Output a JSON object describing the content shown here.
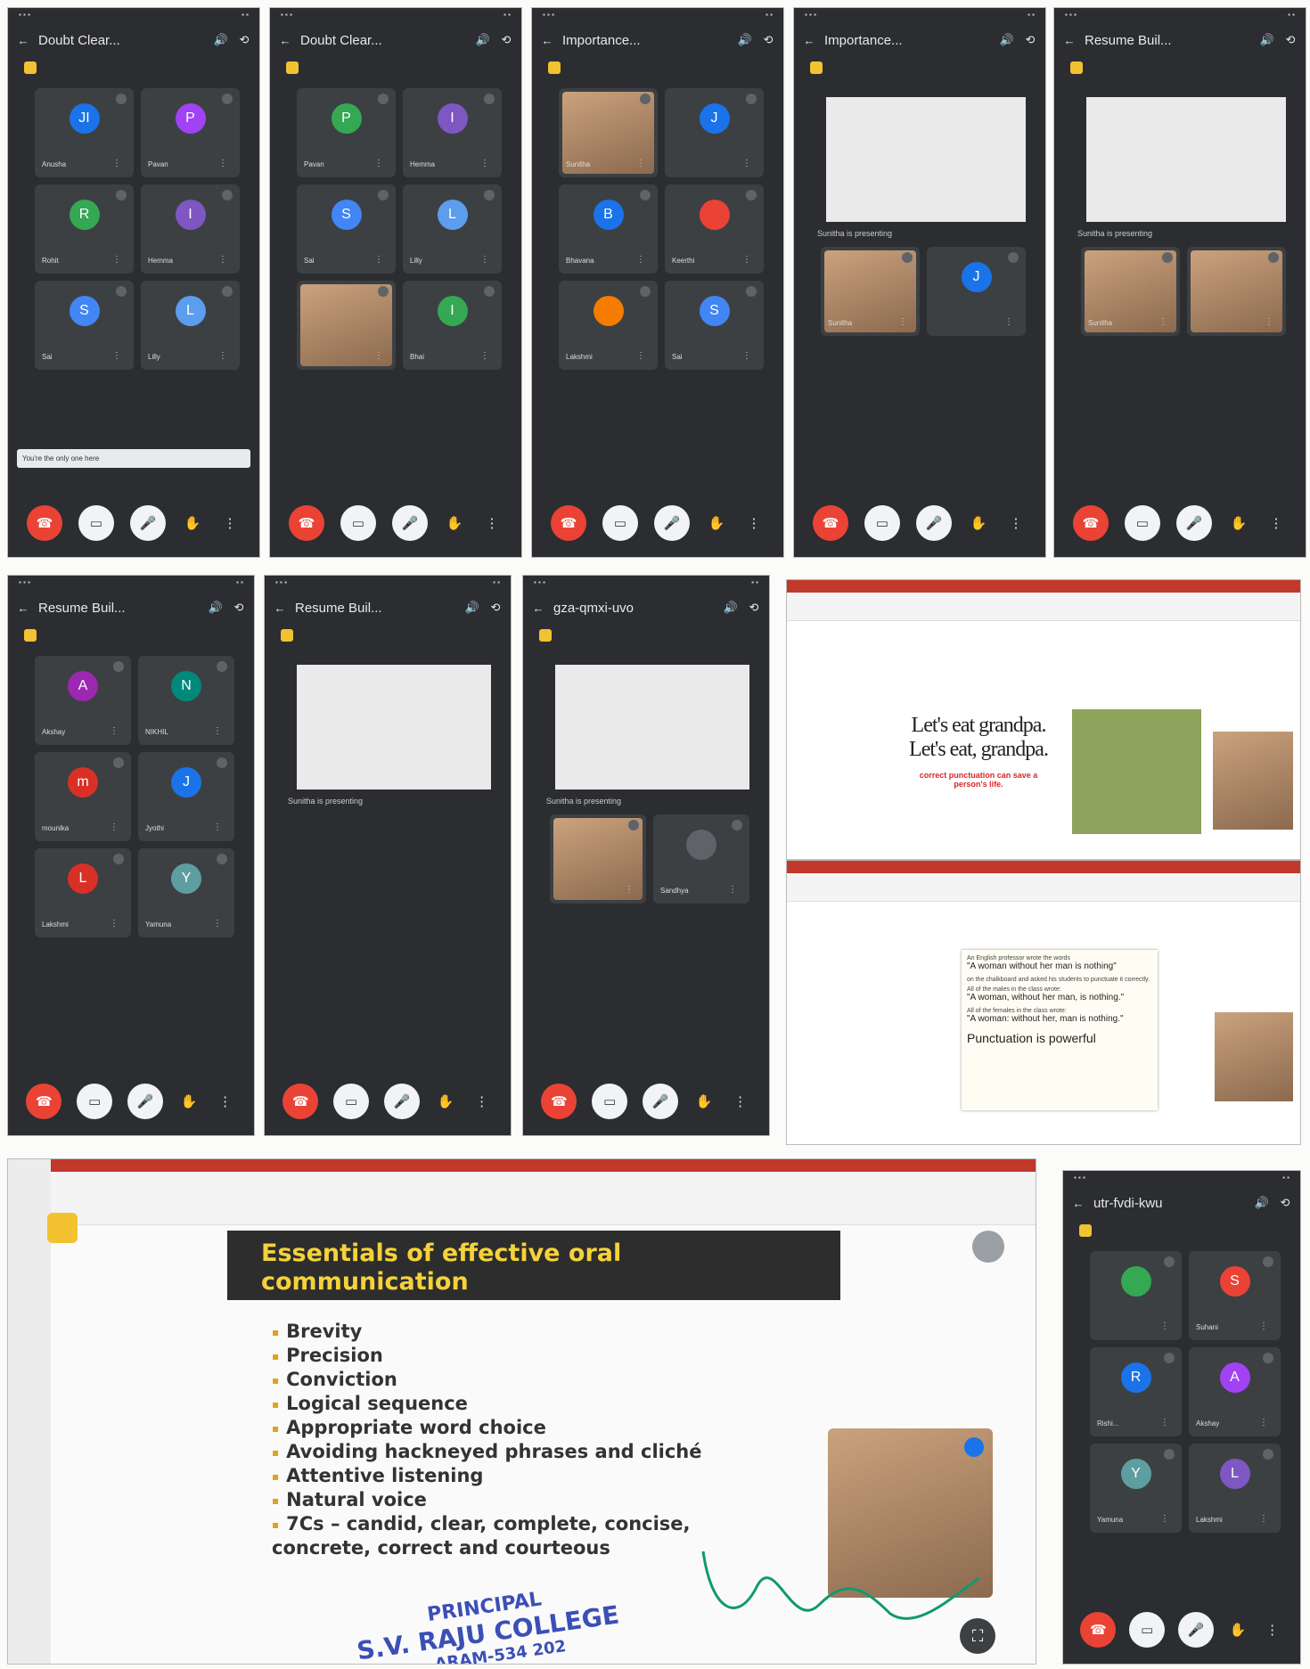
{
  "phones_row1": [
    {
      "title": "Doubt Clear...",
      "participants": [
        {
          "initial": "JI",
          "name": "Anusha",
          "color": "#1a73e8"
        },
        {
          "initial": "P",
          "name": "Pavan",
          "color": "#a142f4"
        },
        {
          "initial": "R",
          "name": "Rohit",
          "color": "#34a853"
        },
        {
          "initial": "I",
          "name": "Hemma",
          "color": "#7e57c2"
        },
        {
          "initial": "S",
          "name": "Sai",
          "color": "#4285f4"
        },
        {
          "initial": "L",
          "name": "Lilly",
          "color": "#5c9ded"
        }
      ],
      "notice": "You're the only one here"
    },
    {
      "title": "Doubt Clear...",
      "participants": [
        {
          "initial": "P",
          "name": "Pavan",
          "color": "#34a853"
        },
        {
          "initial": "I",
          "name": "Hemma",
          "color": "#7e57c2"
        },
        {
          "initial": "S",
          "name": "Sai",
          "color": "#4285f4"
        },
        {
          "initial": "L",
          "name": "Lilly",
          "color": "#5c9ded"
        },
        {
          "initial": "",
          "name": "",
          "color": ""
        },
        {
          "initial": "I",
          "name": "Bhai",
          "color": "#34a853"
        }
      ],
      "notice": ""
    },
    {
      "title": "Importance...",
      "participants": [
        {
          "initial": "",
          "name": "Sunitha",
          "color": ""
        },
        {
          "initial": "J",
          "name": "",
          "color": "#1a73e8"
        },
        {
          "initial": "B",
          "name": "Bhavana",
          "color": "#1a73e8"
        },
        {
          "initial": "",
          "name": "Keerthi",
          "color": "#ea4335"
        },
        {
          "initial": "",
          "name": "Lakshmi",
          "color": "#f57c00"
        },
        {
          "initial": "S",
          "name": "Sai",
          "color": "#4285f4"
        }
      ],
      "notice": ""
    },
    {
      "title": "Importance...",
      "participants": [
        {
          "initial": "",
          "name": "Sunitha",
          "color": ""
        },
        {
          "initial": "J",
          "name": "",
          "color": "#1a73e8"
        }
      ],
      "presenting": "Sunitha is presenting",
      "notice": ""
    },
    {
      "title": "Resume Buil...",
      "participants": [
        {
          "initial": "",
          "name": "Sunitha",
          "color": ""
        },
        {
          "initial": "",
          "name": "",
          "color": ""
        }
      ],
      "presenting": "Sunitha is presenting",
      "notice": ""
    }
  ],
  "phones_row2": [
    {
      "title": "Resume Buil...",
      "participants": [
        {
          "initial": "A",
          "name": "Akshay",
          "color": "#9c27b0"
        },
        {
          "initial": "N",
          "name": "NIKHIL",
          "color": "#00897b"
        },
        {
          "initial": "m",
          "name": "mounika",
          "color": "#d93025"
        },
        {
          "initial": "J",
          "name": "Jyothi",
          "color": "#1a73e8"
        },
        {
          "initial": "L",
          "name": "Lakshmi",
          "color": "#d93025"
        },
        {
          "initial": "Y",
          "name": "Yamuna",
          "color": "#5f9ea0"
        }
      ],
      "notice": ""
    },
    {
      "title": "Resume Buil...",
      "participants": [],
      "presenting": "Sunitha is presenting",
      "notice": ""
    },
    {
      "title": "gza-qmxi-uvo",
      "participants": [
        {
          "initial": "",
          "name": "",
          "color": ""
        },
        {
          "initial": "",
          "name": "Sandhya",
          "color": "#5f6368"
        }
      ],
      "presenting": "Sunitha is presenting",
      "notice": ""
    }
  ],
  "slide_top": {
    "line1": "Let's eat grandpa.",
    "line2": "Let's eat, grandpa.",
    "caption": "correct punctuation can save a person's life."
  },
  "slide_mid": {
    "lines": [
      "An English professor wrote the words",
      "\"A woman without her man is nothing\"",
      "on the chalkboard and asked his students to punctuate it correctly.",
      "All of the males in the class wrote:",
      "\"A woman, without her man, is nothing.\"",
      "All of the females in the class wrote:",
      "\"A woman: without her, man is nothing.\""
    ],
    "conclusion": "Punctuation is powerful"
  },
  "slide_main": {
    "title": "Essentials of effective oral communication",
    "bullets": [
      "Brevity",
      "Precision",
      "Conviction",
      "Logical sequence",
      "Appropriate word choice",
      "Avoiding hackneyed phrases and cliché",
      "Attentive listening",
      "Natural voice",
      "7Cs – candid, clear, complete, concise, concrete, correct and courteous"
    ]
  },
  "phone_last": {
    "title": "utr-fvdi-kwu",
    "participants": [
      {
        "initial": "",
        "name": "",
        "color": "#34a853"
      },
      {
        "initial": "S",
        "name": "Suhani",
        "color": "#ea4335"
      },
      {
        "initial": "R",
        "name": "Rishi...",
        "color": "#1a73e8"
      },
      {
        "initial": "A",
        "name": "Akshay",
        "color": "#a142f4"
      },
      {
        "initial": "Y",
        "name": "Yamuna",
        "color": "#5f9ea0"
      },
      {
        "initial": "L",
        "name": "Lakshmi",
        "color": "#7e57c2"
      }
    ]
  },
  "stamp": {
    "line1": "PRINCIPAL",
    "line2": "S.V. RAJU COLLEGE",
    "line3": "...ARAM-534 202"
  }
}
